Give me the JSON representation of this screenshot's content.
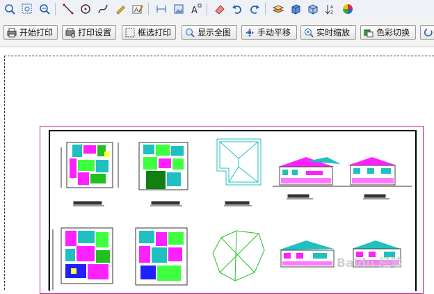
{
  "toolbar_icons": [
    "zoom-in-icon",
    "zoom-window-icon",
    "zoom-out-icon",
    "line-icon",
    "circle-icon",
    "curve-icon",
    "pencil-icon",
    "text-edit-icon",
    "dimension-icon",
    "image-icon",
    "text-icon",
    "eraser-icon",
    "undo-icon",
    "redo-icon",
    "layers-icon",
    "cube-icon",
    "cube3d-icon",
    "sort-icon",
    "color-wheel-icon"
  ],
  "buttons": {
    "print": "开始打印",
    "print_settings": "打印设置",
    "box_print": "框选打印",
    "show_all": "显示全图",
    "pan": "手动平移",
    "realtime_zoom": "实时缩放",
    "color_switch": "色彩切换"
  },
  "watermark": "Baidu 经验",
  "colors": {
    "sheet_border": "#c0208a",
    "toolbar_bg": "#eef2f7"
  }
}
